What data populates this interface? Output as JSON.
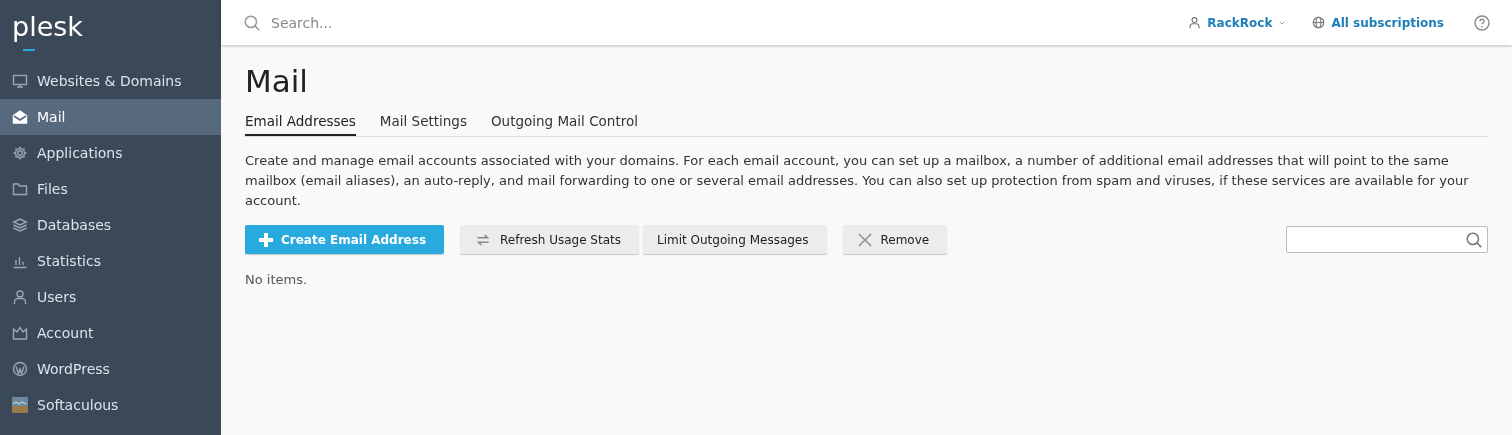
{
  "sidebar": {
    "logo": "plesk",
    "items": [
      {
        "label": "Websites & Domains",
        "selected": false
      },
      {
        "label": "Mail",
        "selected": true
      },
      {
        "label": "Applications",
        "selected": false
      },
      {
        "label": "Files",
        "selected": false
      },
      {
        "label": "Databases",
        "selected": false
      },
      {
        "label": "Statistics",
        "selected": false
      },
      {
        "label": "Users",
        "selected": false
      },
      {
        "label": "Account",
        "selected": false
      },
      {
        "label": "WordPress",
        "selected": false
      },
      {
        "label": "Softaculous",
        "selected": false
      }
    ]
  },
  "topbar": {
    "search": {
      "placeholder": "Search..."
    },
    "user": "RackRock",
    "subscriptions": "All subscriptions"
  },
  "page": {
    "title": "Mail",
    "tabs": [
      {
        "label": "Email Addresses",
        "selected": true
      },
      {
        "label": "Mail Settings",
        "selected": false
      },
      {
        "label": "Outgoing Mail Control",
        "selected": false
      }
    ],
    "description": "Create and manage email accounts associated with your domains. For each email account, you can set up a mailbox, a number of additional email addresses that will point to the same mailbox (email aliases), an auto-reply, and mail forwarding to one or several email addresses. You can also set up protection from spam and viruses, if these services are available for your account.",
    "buttons": [
      {
        "label": "Create Email Address",
        "kind": "primary"
      },
      {
        "label": "Refresh Usage Stats",
        "kind": "default"
      },
      {
        "label": "Limit Outgoing Messages",
        "kind": "default"
      },
      {
        "label": "Remove",
        "kind": "default"
      }
    ],
    "empty_message": "No items."
  }
}
